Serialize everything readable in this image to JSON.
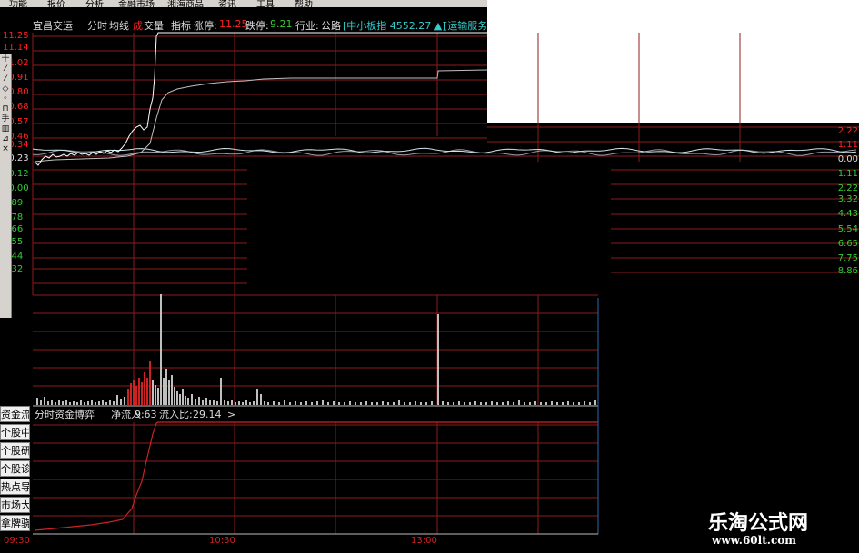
{
  "menu": [
    "功能",
    "报价",
    "分析",
    "金融市场",
    "湘海商品",
    "资讯",
    "工具",
    "帮助"
  ],
  "header": {
    "stock_name": "宜昌交运",
    "tab_intraday": "分时",
    "tab_avg": "均线",
    "tab_vol_prefix": "成",
    "tab_vol": "交量",
    "tab_indicator": "指标",
    "limit_up_label": "涨停:",
    "limit_up_value": "11.25",
    "limit_down_label": "跌停:",
    "limit_down_value": "9.21",
    "industry_label": "行业:",
    "industry_value": "公路",
    "index_info": "[中小板指 4552.27 ▲]",
    "sector_info": "[运输服务"
  },
  "price_axis_left": [
    "11.25",
    "11.14",
    "11.02",
    "10.91",
    "10.80",
    "10.68",
    "10.57",
    "10.46",
    "10.34",
    "10.23",
    "10.12",
    "10.00",
    "9.89",
    "9.78",
    "9.66",
    "9.55",
    "9.44",
    "9.32"
  ],
  "pct_axis_right": [
    "2.22",
    "1.11",
    "0.00",
    "1.11",
    "2.22",
    "3.32",
    "4.43",
    "5.54",
    "6.65",
    "7.75",
    "8.86"
  ],
  "fund_panel": {
    "title": "分时资金博弈",
    "inflow_label": "净流入:",
    "inflow_value": "9.63",
    "ratio_label": "流入比:",
    "ratio_value": "29.14",
    "arrow": ">"
  },
  "side_tabs": [
    "资金流向",
    "个股中快讯",
    "个股研报",
    "个股诊断",
    "热点导航",
    "市场大势",
    "拿牌骁马"
  ],
  "left_tools": [
    "十",
    "⁄",
    "⁄",
    "◇",
    "◦",
    "⊓",
    "手",
    "▥",
    "⊿",
    "×"
  ],
  "time_labels": [
    "09:30",
    "10:30",
    "13:00"
  ],
  "logo": {
    "title": "乐淘公式网",
    "url": "www.60lt.com"
  },
  "colors": {
    "background": "#000000",
    "grid_red": "#8c1c1c",
    "price_line": "#ffffff",
    "avg_line": "#bfbfbf",
    "volume_up": "#cc2222",
    "volume_down": "#bfbfbf",
    "fund_line": "#cc2222",
    "limit_up": "#ff2222",
    "header_text": "#dddddd",
    "index_text": "#33cccc",
    "right_axis_text": "#dddddd"
  }
}
